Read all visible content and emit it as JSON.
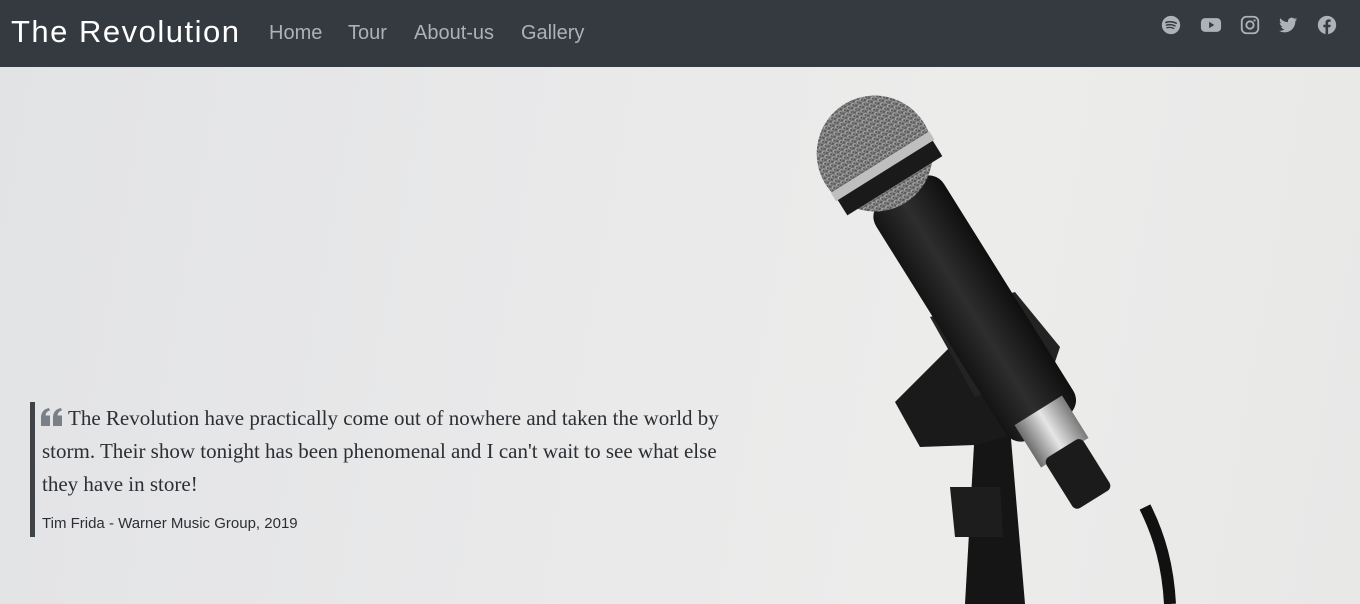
{
  "header": {
    "brand": "The Revolution",
    "nav": [
      {
        "label": "Home"
      },
      {
        "label": "Tour"
      },
      {
        "label": "About-us"
      },
      {
        "label": "Gallery"
      }
    ],
    "social_icons": [
      "spotify-icon",
      "youtube-icon",
      "instagram-icon",
      "twitter-icon",
      "facebook-icon"
    ]
  },
  "hero": {
    "quote": "The Revolution have practically come out of nowhere and taken the world by storm. Their show tonight has been phenomenal and I can't wait to see what else they have in store!",
    "source": "Tim Frida - Warner Music Group, 2019"
  },
  "colors": {
    "navbar": "#343a40",
    "nav_link": "#aeb1b5",
    "brand": "#ffffff",
    "quote_border": "#3f4348",
    "quote_icon": "#7a8088"
  }
}
